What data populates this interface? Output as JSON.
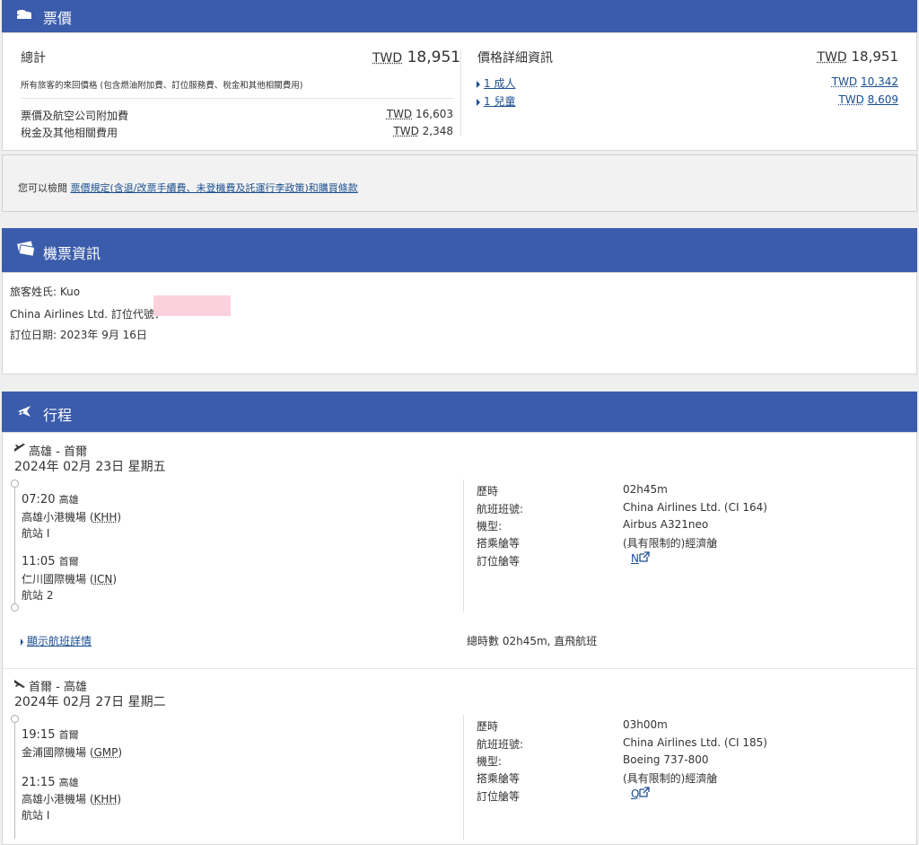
{
  "fare": {
    "header": "票價",
    "total_label": "總計",
    "total_currency": "TWD",
    "total_amount": "18,951",
    "note": "所有旅客的來回價格 (包含燃油附加費、訂位服務費、稅金和其他相關費用)",
    "lines": [
      {
        "label": "票價及航空公司附加費",
        "currency": "TWD",
        "amount": "16,603"
      },
      {
        "label": "稅金及其他相關費用",
        "currency": "TWD",
        "amount": "2,348"
      }
    ],
    "detail_title": "價格詳細資訊",
    "detail_currency": "TWD",
    "detail_total": "18,951",
    "passengers": [
      {
        "label": "1 成人",
        "currency": "TWD",
        "amount": "10,342"
      },
      {
        "label": "1 兒童",
        "currency": "TWD",
        "amount": "8,609"
      }
    ]
  },
  "rules": {
    "prefix": "您可以檢閱",
    "link": "票價規定(含退/改票手續費、未登機費及託運行李政策)和購買條款"
  },
  "ticket": {
    "header": "機票資訊",
    "passenger_line": "旅客姓氏:  Kuo",
    "booking_code_label": "China Airlines Ltd. 訂位代號：",
    "booking_date_line": "訂位日期:  2023年 9月 16日"
  },
  "itinerary": {
    "header": "行程",
    "flights": [
      {
        "route": "高雄 - 首爾",
        "date": "2024年 02月 23日 星期五",
        "dep_time": "07:20",
        "dep_city": "高雄",
        "dep_airport": "高雄小港機場 (",
        "dep_code": "KHH",
        "dep_terminal": "航站 I",
        "arr_time": "11:05",
        "arr_city": "首爾",
        "arr_airport": "仁川國際機場 (",
        "arr_code": "ICN",
        "arr_terminal": "航站 2",
        "labels": [
          "歷時",
          "航班班號:",
          "機型:",
          "搭乘艙等",
          "訂位艙等"
        ],
        "duration": "02h45m",
        "flight_no": "China Airlines Ltd. (CI 164)",
        "aircraft": "Airbus A321neo",
        "cabin": "(具有限制的)經濟艙",
        "booking_class": "N",
        "show_details": "顯示航班詳情",
        "summary": "總時數 02h45m, 直飛航班"
      },
      {
        "route": "首爾 - 高雄",
        "date": "2024年 02月 27日 星期二",
        "dep_time": "19:15",
        "dep_city": "首爾",
        "dep_airport": "金浦國際機場 (",
        "dep_code": "GMP",
        "arr_time": "21:15",
        "arr_city": "高雄",
        "arr_airport": "高雄小港機場 (",
        "arr_code": "KHH",
        "arr_terminal": "航站 I",
        "labels": [
          "歷時",
          "航班班號:",
          "機型:",
          "搭乘艙等",
          "訂位艙等"
        ],
        "duration": "03h00m",
        "flight_no": "China Airlines Ltd. (CI 185)",
        "aircraft": "Boeing 737-800",
        "cabin": "(具有限制的)經濟艙",
        "booking_class": "Q"
      }
    ]
  },
  "colors": {
    "header_bg": "#3b5cab",
    "link": "#1a4f8f",
    "mask": "#f9d2de"
  },
  "icons": [
    "coins-icon",
    "ticket-icon",
    "plane-icon",
    "plane-depart-icon",
    "plane-arrive-icon",
    "external-link-icon"
  ]
}
